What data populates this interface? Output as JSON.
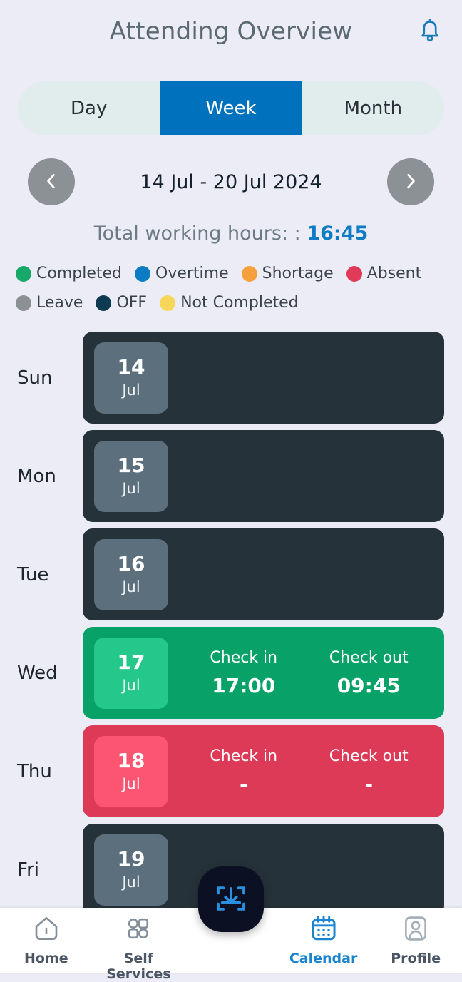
{
  "header": {
    "title": "Attending Overview",
    "bell_icon": "bell-icon"
  },
  "view_tabs": {
    "options": [
      "Day",
      "Week",
      "Month"
    ],
    "selected": "Week",
    "active_color": "#0071bd"
  },
  "date_nav": {
    "prev_icon": "chevron-left-icon",
    "next_icon": "chevron-right-icon",
    "range": "14 Jul - 20 Jul 2024"
  },
  "summary": {
    "label": "Total working hours: : ",
    "value": "16:45",
    "value_color": "#0d7cc4"
  },
  "legend": {
    "row1": [
      {
        "label": "Completed",
        "color": "#17a86a"
      },
      {
        "label": "Overtime",
        "color": "#0b7cc4"
      },
      {
        "label": "Shortage",
        "color": "#f5a03c"
      },
      {
        "label": "Absent",
        "color": "#e03a58"
      }
    ],
    "row2": [
      {
        "label": "Leave",
        "color": "#8c9196"
      },
      {
        "label": "OFF",
        "color": "#0c3a50"
      },
      {
        "label": "Not Completed",
        "color": "#f7d65a"
      }
    ]
  },
  "check_headers": {
    "check_in": "Check in",
    "check_out": "Check out"
  },
  "days": [
    {
      "weekday": "Sun",
      "date": "14",
      "month": "Jul",
      "status": "OFF",
      "card_color": "#26323a",
      "chip_color": "#5c6f7c",
      "show_checks": false,
      "check_in": "",
      "check_out": ""
    },
    {
      "weekday": "Mon",
      "date": "15",
      "month": "Jul",
      "status": "OFF",
      "card_color": "#26323a",
      "chip_color": "#5c6f7c",
      "show_checks": false,
      "check_in": "",
      "check_out": ""
    },
    {
      "weekday": "Tue",
      "date": "16",
      "month": "Jul",
      "status": "OFF",
      "card_color": "#26323a",
      "chip_color": "#5c6f7c",
      "show_checks": false,
      "check_in": "",
      "check_out": ""
    },
    {
      "weekday": "Wed",
      "date": "17",
      "month": "Jul",
      "status": "Completed",
      "card_color": "#08a168",
      "chip_color": "#23c88a",
      "show_checks": true,
      "check_in": "17:00",
      "check_out": "09:45"
    },
    {
      "weekday": "Thu",
      "date": "18",
      "month": "Jul",
      "status": "Absent",
      "card_color": "#dd3a58",
      "chip_color": "#fc5572",
      "show_checks": true,
      "check_in": "-",
      "check_out": "-"
    },
    {
      "weekday": "Fri",
      "date": "19",
      "month": "Jul",
      "status": "OFF",
      "card_color": "#26323a",
      "chip_color": "#5c6f7c",
      "show_checks": false,
      "check_in": "",
      "check_out": ""
    }
  ],
  "bottom_nav": {
    "items": [
      {
        "label": "Home",
        "icon": "home-icon",
        "active": false
      },
      {
        "label": "Self Services",
        "icon": "grid-apps-icon",
        "active": false
      },
      {
        "label": "Calendar",
        "icon": "calendar-icon",
        "active": true
      },
      {
        "label": "Profile",
        "icon": "user-profile-icon",
        "active": false
      }
    ],
    "fab": {
      "icon": "scan-check-in-icon",
      "color": "#0b1022"
    },
    "active_color": "#1b84d0"
  }
}
